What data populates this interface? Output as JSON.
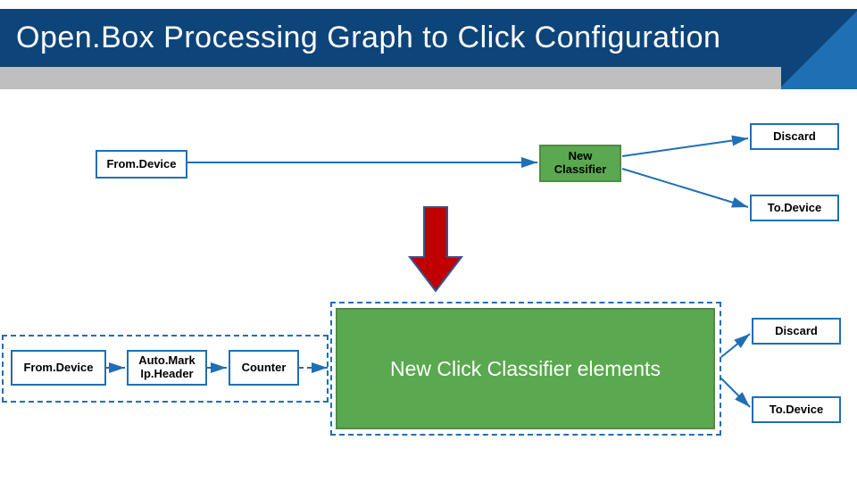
{
  "title": "Open.Box Processing Graph to Click Configuration",
  "top": {
    "from": "From.Device",
    "classifier_line1": "New",
    "classifier_line2": "Classifier",
    "discard": "Discard",
    "todevice": "To.Device"
  },
  "bottom": {
    "from": "From.Device",
    "automark_line1": "Auto.Mark",
    "automark_line2": "Ip.Header",
    "counter": "Counter",
    "biggreen": "New Click Classifier elements",
    "discard": "Discard",
    "todevice": "To.Device"
  },
  "colors": {
    "blue": "#1f6fb5",
    "darkblue": "#0d457a",
    "green": "#5aa84f",
    "red": "#c00000"
  }
}
